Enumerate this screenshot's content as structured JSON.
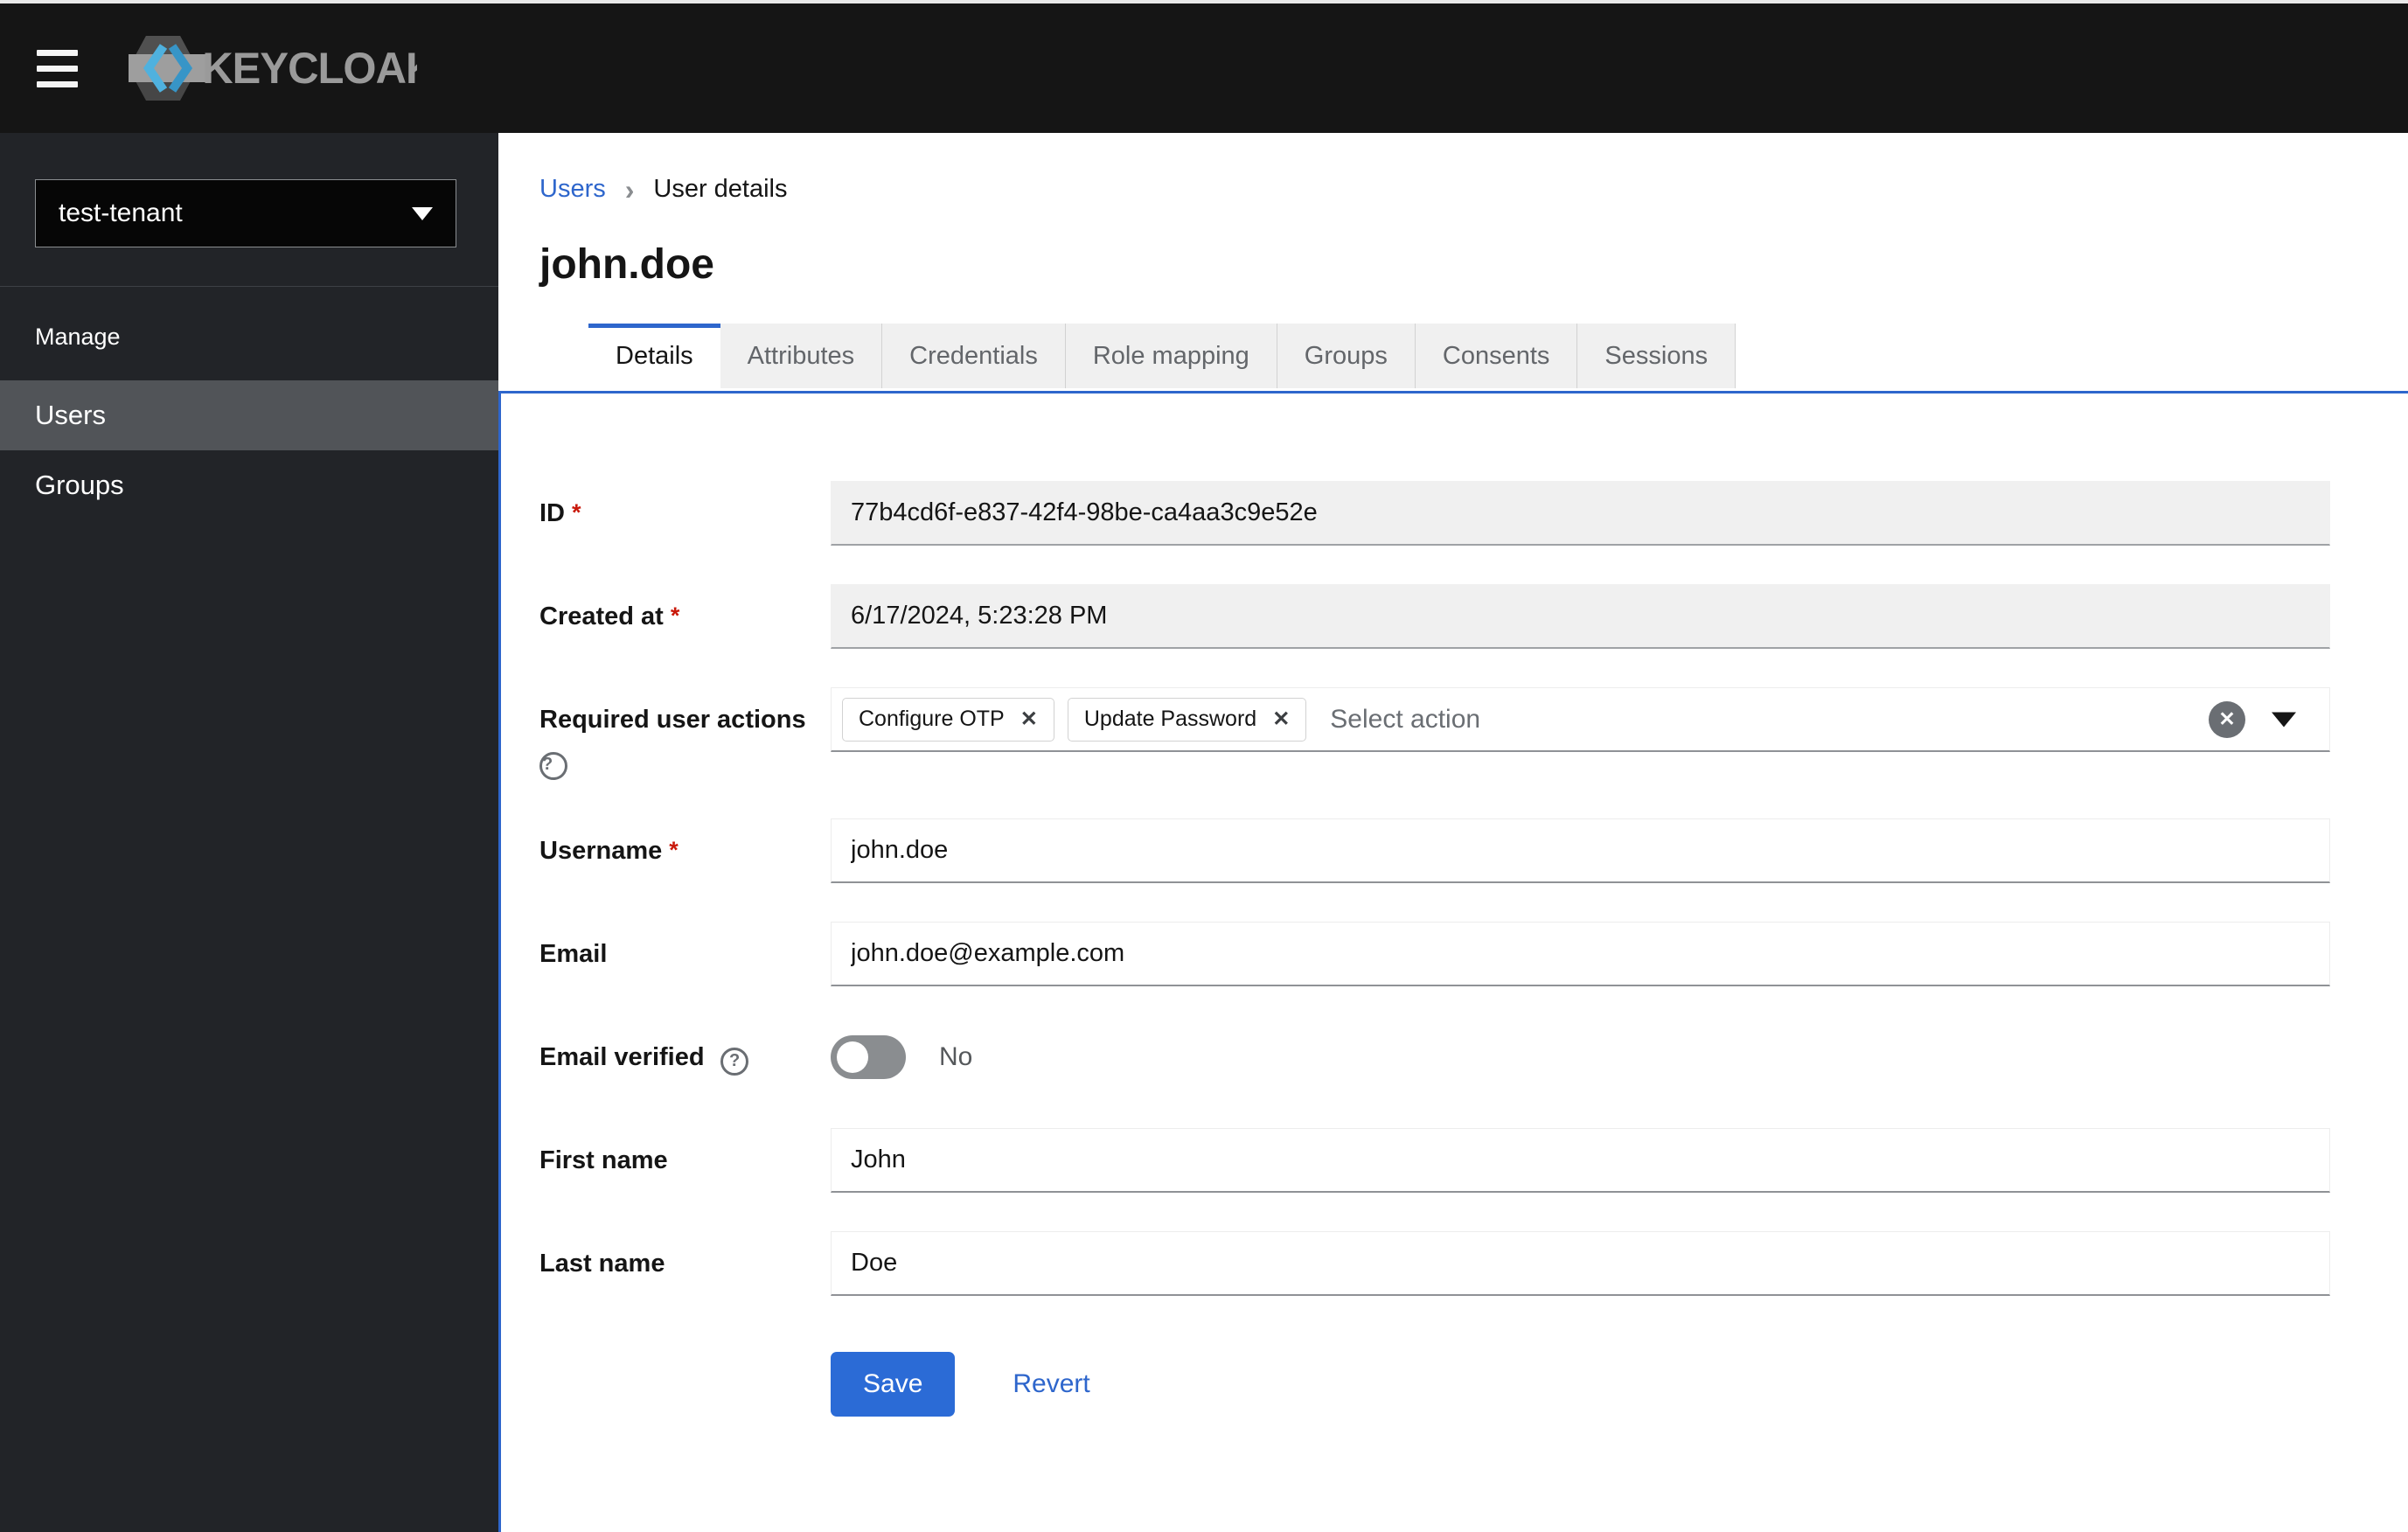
{
  "masthead": {
    "brand": "KEYCLOAK"
  },
  "sidebar": {
    "realm_selector": {
      "value": "test-tenant"
    },
    "section_label": "Manage",
    "items": [
      {
        "label": "Users",
        "active": true
      },
      {
        "label": "Groups",
        "active": false
      }
    ]
  },
  "breadcrumb": {
    "items": [
      {
        "label": "Users",
        "link": true
      },
      {
        "label": "User details",
        "link": false
      }
    ]
  },
  "page": {
    "title": "john.doe"
  },
  "tabs": [
    {
      "label": "Details",
      "active": true
    },
    {
      "label": "Attributes",
      "active": false
    },
    {
      "label": "Credentials",
      "active": false
    },
    {
      "label": "Role mapping",
      "active": false
    },
    {
      "label": "Groups",
      "active": false
    },
    {
      "label": "Consents",
      "active": false
    },
    {
      "label": "Sessions",
      "active": false
    }
  ],
  "form": {
    "required_indicator": "*",
    "id": {
      "label": "ID",
      "required": true,
      "value": "77b4cd6f-e837-42f4-98be-ca4aa3c9e52e",
      "disabled": true
    },
    "created_at": {
      "label": "Created at",
      "required": true,
      "value": "6/17/2024, 5:23:28 PM",
      "disabled": true
    },
    "required_user_actions": {
      "label": "Required user actions",
      "chips": [
        "Configure OTP",
        "Update Password"
      ],
      "placeholder": "Select action"
    },
    "username": {
      "label": "Username",
      "required": true,
      "value": "john.doe"
    },
    "email": {
      "label": "Email",
      "value": "john.doe@example.com"
    },
    "email_verified": {
      "label": "Email verified",
      "state": "No",
      "enabled": false
    },
    "first_name": {
      "label": "First name",
      "value": "John"
    },
    "last_name": {
      "label": "Last name",
      "value": "Doe"
    }
  },
  "actions": {
    "save_label": "Save",
    "revert_label": "Revert"
  },
  "icons": {
    "help": "?",
    "close": "✕",
    "breadcrumb_separator": "›"
  },
  "colors": {
    "primary_blue": "#2b6bd6",
    "link_blue": "#2e66cc",
    "danger_red": "#c9190b",
    "masthead_bg": "#151515",
    "sidebar_bg": "#222428",
    "sidebar_active_bg": "#515458",
    "disabled_input_bg": "#f0f0f0",
    "input_bottom_border": "#8f9296"
  }
}
